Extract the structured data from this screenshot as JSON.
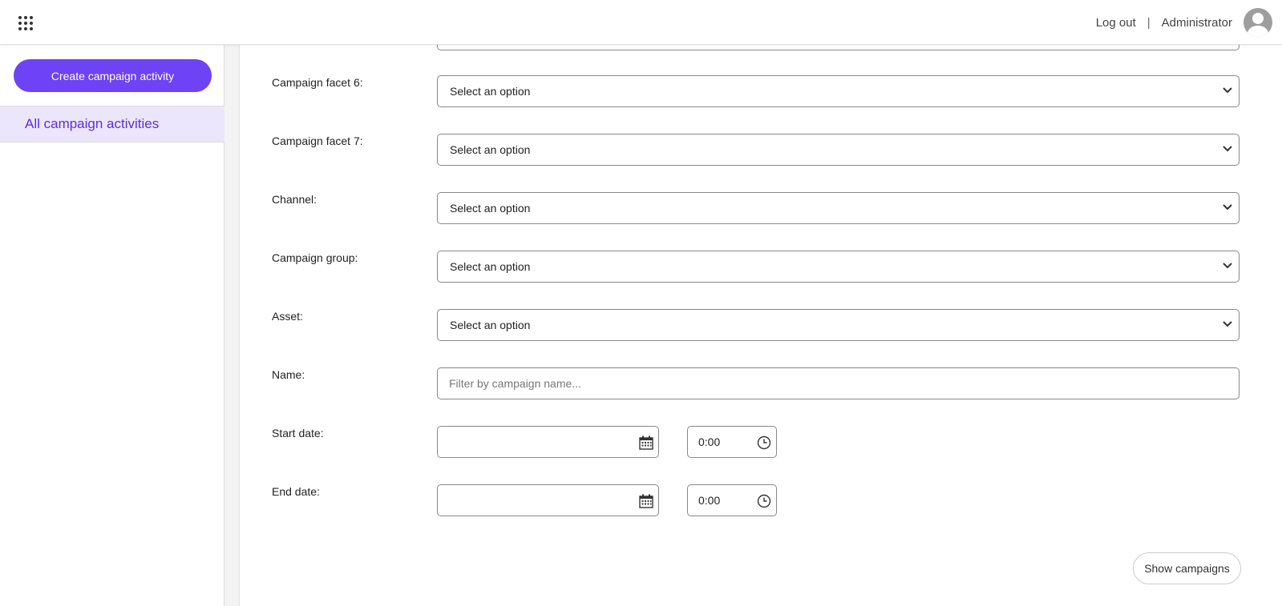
{
  "header": {
    "logout": "Log out",
    "separator": "|",
    "user": "Administrator",
    "apps_icon": "grid-apps-icon",
    "avatar_icon": "user-avatar-icon"
  },
  "sidebar": {
    "create_button": "Create campaign activity",
    "items": [
      {
        "label": "All campaign activities"
      }
    ]
  },
  "filters": {
    "selects": [
      {
        "label": "Campaign facet 6:",
        "value": "Select an option"
      },
      {
        "label": "Campaign facet 7:",
        "value": "Select an option"
      },
      {
        "label": "Channel:",
        "value": "Select an option"
      },
      {
        "label": "Campaign group:",
        "value": "Select an option"
      },
      {
        "label": "Asset:",
        "value": "Select an option"
      }
    ],
    "name": {
      "label": "Name:",
      "value": "",
      "placeholder": "Filter by campaign name..."
    },
    "start": {
      "label": "Start date:",
      "date": "",
      "time": "0:00"
    },
    "end": {
      "label": "End date:",
      "date": "",
      "time": "0:00"
    },
    "submit": "Show campaigns"
  },
  "colors": {
    "accent": "#6e42f5",
    "nav_active_bg": "#ebe6fc",
    "nav_active_text": "#5b2ee0"
  }
}
